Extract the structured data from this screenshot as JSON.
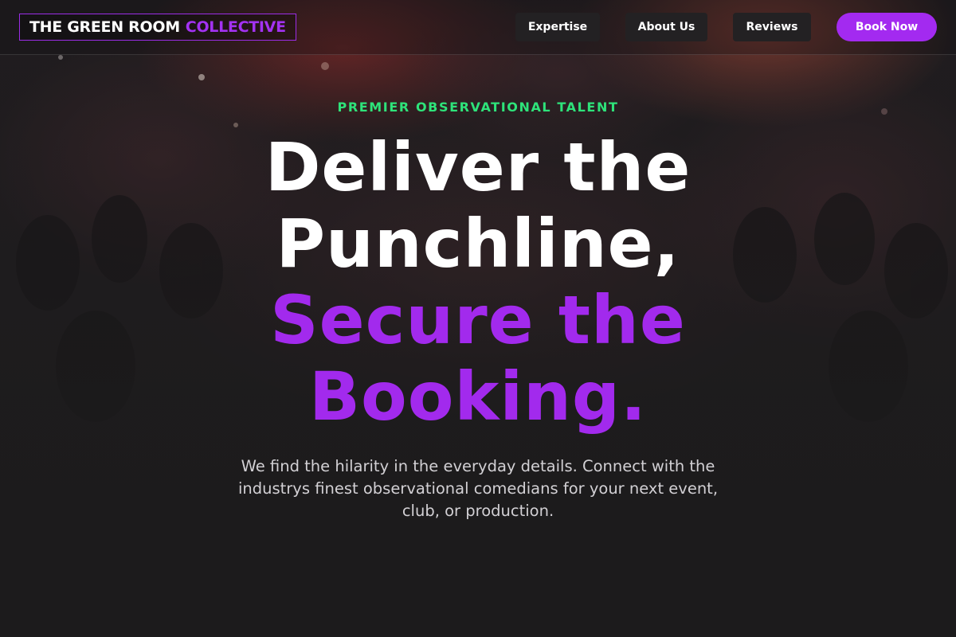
{
  "header": {
    "logo_white": "THE GREEN ROOM",
    "logo_purple": "COLLECTIVE",
    "nav": {
      "expertise": "Expertise",
      "about": "About Us",
      "reviews": "Reviews"
    },
    "cta_label": "Book Now"
  },
  "hero": {
    "eyebrow": "PREMIER OBSERVATIONAL TALENT",
    "headline_line1": "Deliver the",
    "headline_line2": "Punchline,",
    "headline_line3": "Secure the",
    "headline_line4": "Booking.",
    "subtitle": "We find the hilarity in the everyday details. Connect with the industrys finest observational comedians for your next event, club, or production."
  },
  "colors": {
    "accent_purple": "#a32af0",
    "accent_green": "#2ee37a",
    "background": "#1c1b1c"
  }
}
